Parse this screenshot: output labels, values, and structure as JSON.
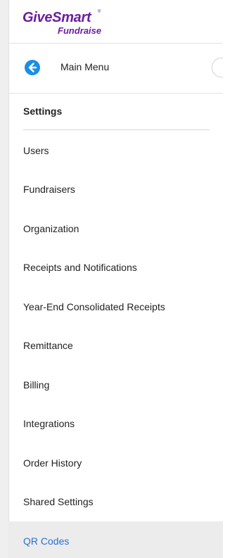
{
  "brand": {
    "name": "GiveSmart",
    "trademark": "®",
    "product": "Fundraise",
    "color": "#6a1fa0"
  },
  "main_menu": {
    "label": "Main Menu",
    "icon": "arrow-left-circle-icon",
    "icon_color": "#1a8fe3"
  },
  "section": {
    "title": "Settings"
  },
  "nav": {
    "active_color": "#2a6fd1",
    "items": [
      {
        "label": "Users",
        "active": false
      },
      {
        "label": "Fundraisers",
        "active": false
      },
      {
        "label": "Organization",
        "active": false
      },
      {
        "label": "Receipts and Notifications",
        "active": false
      },
      {
        "label": "Year-End Consolidated Receipts",
        "active": false
      },
      {
        "label": "Remittance",
        "active": false
      },
      {
        "label": "Billing",
        "active": false
      },
      {
        "label": "Integrations",
        "active": false
      },
      {
        "label": "Order History",
        "active": false
      },
      {
        "label": "Shared Settings",
        "active": false
      },
      {
        "label": "QR Codes",
        "active": true
      }
    ]
  }
}
